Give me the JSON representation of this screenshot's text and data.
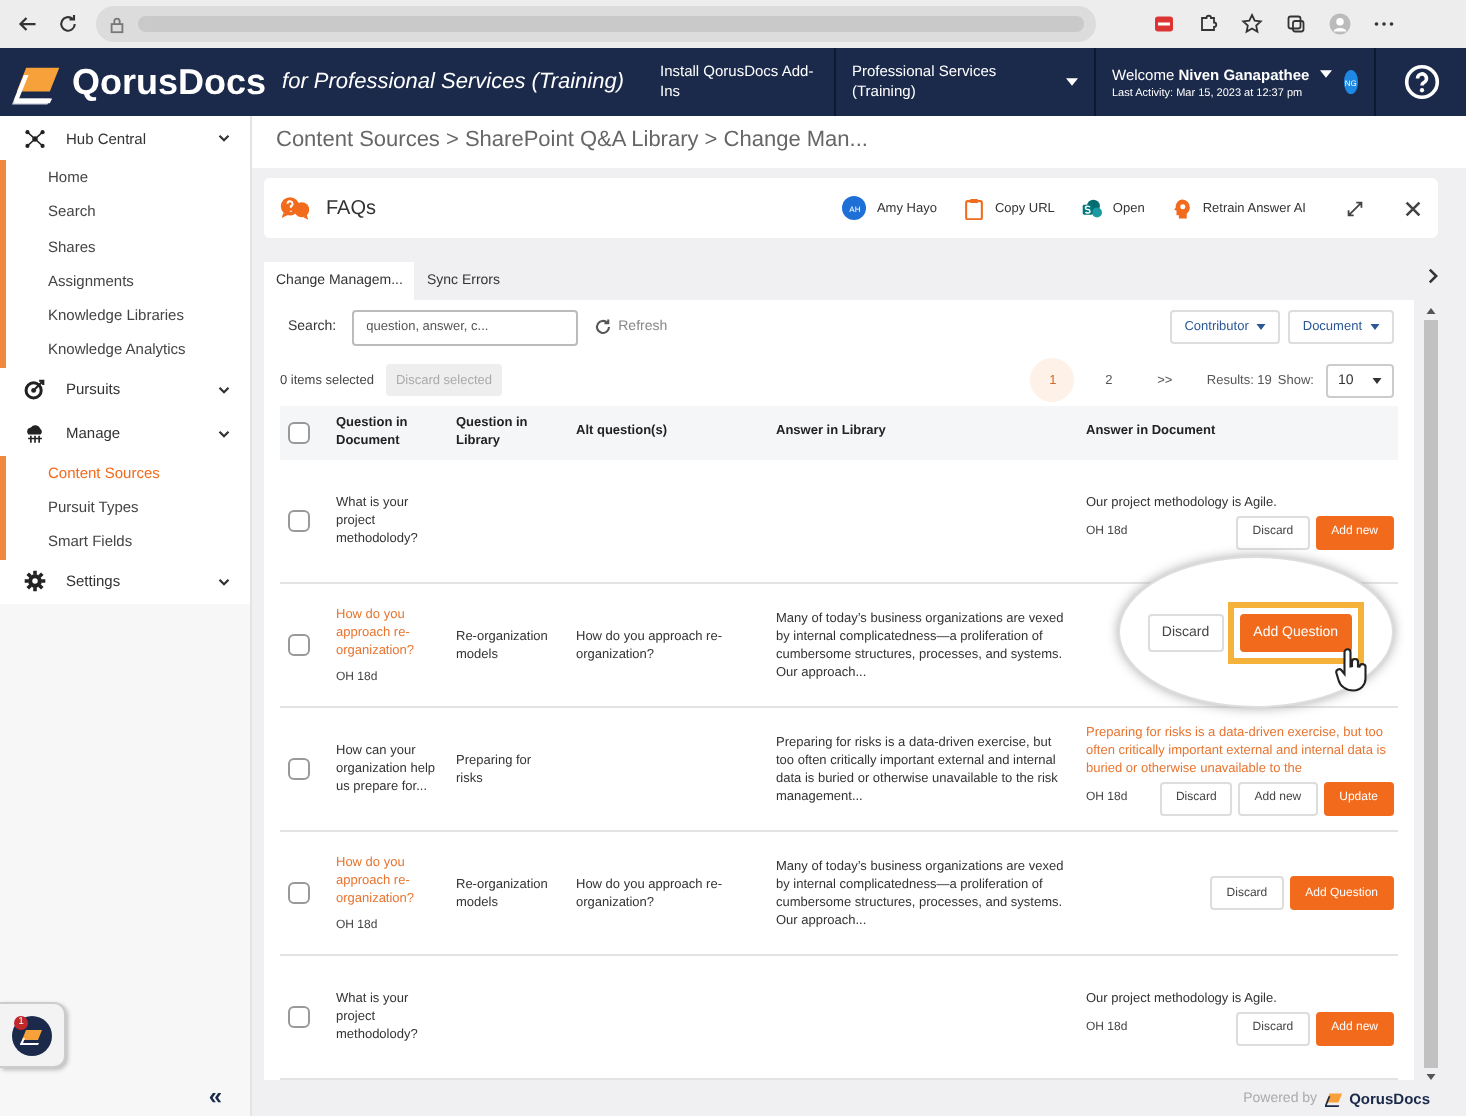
{
  "header": {
    "brand": "QorusDocs",
    "tagline": "for Professional Services (Training)",
    "install_link": "Install QorusDocs Add-Ins",
    "workspace": "Professional Services (Training)",
    "welcome": "Welcome **Niven Ganapathee**",
    "last_activity": "Last Activity: Mar 15, 2023 at 12:37 pm",
    "user_initials": "NG"
  },
  "sidebar": {
    "groups": [
      {
        "label": "Hub Central",
        "expanded": true,
        "children": [
          {
            "label": "Home",
            "selected": false
          },
          {
            "label": "Search",
            "selected": false
          },
          {
            "label": "Shares",
            "selected": false
          },
          {
            "label": "Assignments",
            "selected": false
          },
          {
            "label": "Knowledge Libraries",
            "selected": false
          },
          {
            "label": "Knowledge Analytics",
            "selected": false
          }
        ]
      },
      {
        "label": "Pursuits",
        "expanded": false
      },
      {
        "label": "Manage",
        "expanded": true,
        "children": [
          {
            "label": "Content Sources",
            "selected": true
          },
          {
            "label": "Pursuit Types",
            "selected": false
          },
          {
            "label": "Smart Fields",
            "selected": false
          }
        ]
      },
      {
        "label": "Settings",
        "expanded": false
      }
    ],
    "notification_count": "1",
    "collapse": "«"
  },
  "breadcrumb": "Content Sources > SharePoint Q&A Library > Change Man...",
  "panel": {
    "title": "FAQs",
    "owner": {
      "initials": "AH",
      "name": "Amy Hayo"
    },
    "actions": [
      {
        "label": "Copy URL"
      },
      {
        "label": "Open"
      },
      {
        "label": "Retrain Answer AI"
      }
    ],
    "tabs": [
      {
        "label": "Change Managem...",
        "selected": true
      },
      {
        "label": "Sync Errors",
        "selected": false
      }
    ],
    "search": {
      "label": "Search:",
      "placeholder": "question, answer, c..."
    },
    "refresh": "Refresh",
    "filters": [
      "Contributor",
      "Document"
    ],
    "selection": {
      "count_text": "0 items selected",
      "discard_selected": "Discard selected",
      "disabled": true
    },
    "pagination": {
      "pages": [
        {
          "label": "1",
          "selected": true
        },
        {
          "label": "2",
          "selected": false
        }
      ],
      "next": ">>",
      "results": "Results: 19",
      "show_label": "Show:",
      "page_size": "10"
    },
    "table": {
      "header_checked": false,
      "columns": [
        "Question in Document",
        "Question in Library",
        "Alt question(s)",
        "Answer in Library",
        "Answer in Document"
      ],
      "rows": [
        {
          "checked": false,
          "q_doc": "What is your project methodolody?",
          "q_doc_changed": false,
          "answer_doc": "Our project methodology is Agile.",
          "answer_doc_changed": false,
          "answer_meta": "OH 18d",
          "actions": [
            {
              "label": "Discard",
              "kind": "secondary"
            },
            {
              "label": "Add new",
              "kind": "primary"
            }
          ]
        },
        {
          "checked": false,
          "q_doc": "How do you approach re-organization?",
          "q_doc_changed": true,
          "q_meta": "OH 18d",
          "q_lib": "Re-organization models",
          "alt": "How do you approach re-organization?",
          "answer_lib": "Many of today’s business organizations are vexed by internal complicatedness—a proliferation of cumbersome structures, processes, and systems. Our approach...",
          "magnified": true,
          "actions": [
            {
              "label": "Discard",
              "kind": "secondary"
            },
            {
              "label": "Add Question",
              "kind": "primary"
            }
          ]
        },
        {
          "checked": false,
          "q_doc": "How can your organization help us prepare for...",
          "q_doc_changed": false,
          "q_lib": "Preparing for risks",
          "answer_lib": "Preparing for risks is a data-driven exercise, but too often critically important external and internal data is buried or otherwise unavailable to the risk management...",
          "answer_doc": "Preparing for risks is a data-driven exercise, but too often critically important external and internal data is buried or otherwise unavailable to the",
          "answer_doc_changed": true,
          "answer_meta": "OH 18d",
          "actions": [
            {
              "label": "Discard",
              "kind": "secondary"
            },
            {
              "label": "Add new",
              "kind": "secondary"
            },
            {
              "label": "Update",
              "kind": "primary"
            }
          ]
        },
        {
          "checked": false,
          "q_doc": "How do you approach re-organization?",
          "q_doc_changed": true,
          "q_meta": "OH 18d",
          "q_lib": "Re-organization models",
          "alt": "How do you approach re-organization?",
          "answer_lib": "Many of today’s business organizations are vexed by internal complicatedness—a proliferation of cumbersome structures, processes, and systems. Our approach...",
          "actions": [
            {
              "label": "Discard",
              "kind": "secondary"
            },
            {
              "label": "Add Question",
              "kind": "primary"
            }
          ]
        },
        {
          "checked": false,
          "q_doc": "What is your project methodolody?",
          "q_doc_changed": false,
          "answer_doc": "Our project methodology is Agile.",
          "answer_doc_changed": false,
          "answer_meta": "OH 18d",
          "actions": [
            {
              "label": "Discard",
              "kind": "secondary"
            },
            {
              "label": "Add new",
              "kind": "primary"
            }
          ]
        }
      ]
    }
  },
  "footer": {
    "powered_by": "Powered by",
    "brand": "QorusDocs"
  }
}
